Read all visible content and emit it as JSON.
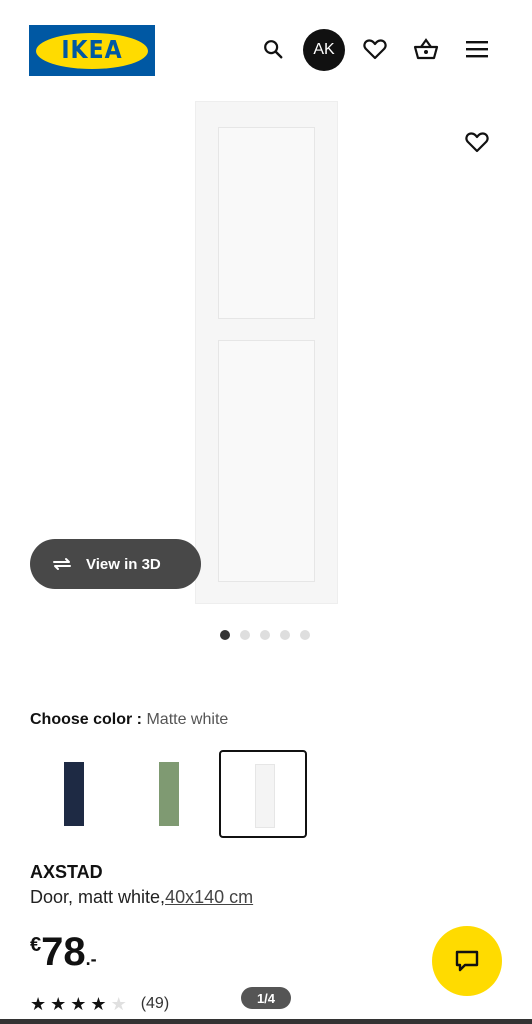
{
  "header": {
    "logo_text": "IKEA",
    "avatar_initials": "AK",
    "icons": [
      "search-icon",
      "heart-icon",
      "basket-icon",
      "menu-icon"
    ]
  },
  "gallery": {
    "view_3d_label": "View in 3D",
    "dot_count": 5,
    "active_dot": 0,
    "pager_text": "1/4"
  },
  "color_chooser": {
    "label": "Choose color :",
    "selected_value": "Matte white",
    "options": [
      {
        "name": "dark blue",
        "color": "#1e2a44"
      },
      {
        "name": "green",
        "color": "#7f9a72"
      },
      {
        "name": "matte white",
        "color": "#f4f4f4",
        "selected": true
      }
    ]
  },
  "product": {
    "name": "AXSTAD",
    "description": "Door, matt white,",
    "size_link": "40x140 cm",
    "price_currency": "€",
    "price_integer": "78",
    "price_decimal": ".-",
    "rating_stars": 4,
    "rating_max": 5,
    "review_count": "(49)"
  },
  "colors": {
    "brand_blue": "#0058a3",
    "brand_yellow": "#ffdb00"
  }
}
